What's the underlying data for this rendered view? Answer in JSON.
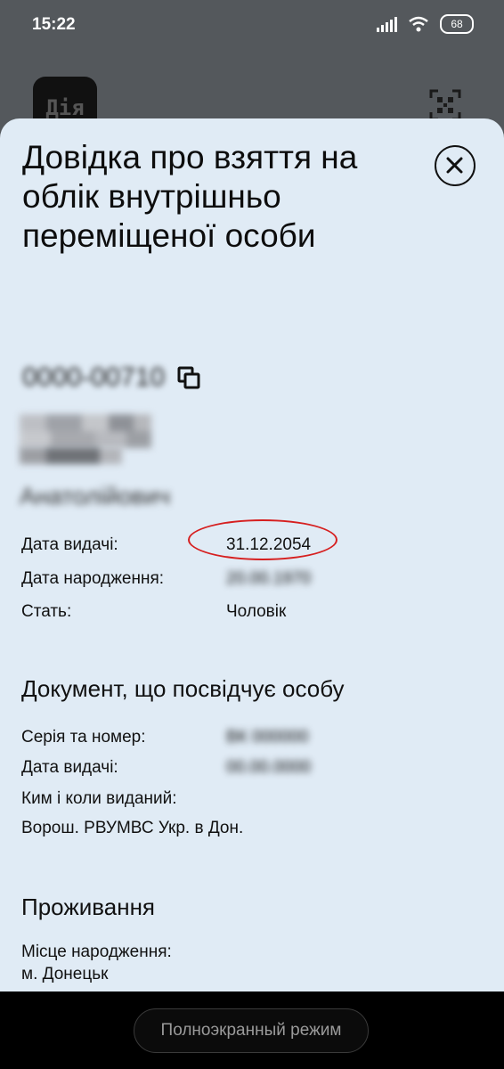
{
  "status_bar": {
    "time": "15:22",
    "battery": "68"
  },
  "app": {
    "logo_text": "Дія"
  },
  "document": {
    "title": "Довідка про взяття на облік внутрішньо переміщеної особи",
    "number": "0000-00710",
    "name_lines": [
      "",
      "",
      "Анатолійович"
    ],
    "fields": [
      {
        "label": "Дата видачі:",
        "value": "31.12.2054"
      },
      {
        "label": "Дата народження:",
        "value": "20.00.1970"
      },
      {
        "label": "Стать:",
        "value": "Чоловік"
      }
    ]
  },
  "identity_section": {
    "title": "Документ, що посвідчує особу",
    "fields": [
      {
        "label": "Серія та номер:",
        "value": "ВК 000000"
      },
      {
        "label": "Дата видачі:",
        "value": "00.00.0000"
      }
    ],
    "issued_by_label": "Ким і коли виданий:",
    "issued_by_value": "Ворош. РВУМВС Укр. в Дон."
  },
  "residence_section": {
    "title": "Проживання",
    "birthplace_label": "Місце народження:",
    "birthplace_value": "м. Донецьк"
  },
  "bottom_bar": {
    "fullscreen_label": "Полноэкранный режим"
  },
  "colors": {
    "sheet_background": "#e0ebf5",
    "header_background": "#54585c",
    "highlight_ring": "#d61f1f"
  },
  "icons": [
    "signal-icon",
    "wifi-icon",
    "battery-icon",
    "qr-scan-icon",
    "close-icon",
    "copy-icon"
  ]
}
